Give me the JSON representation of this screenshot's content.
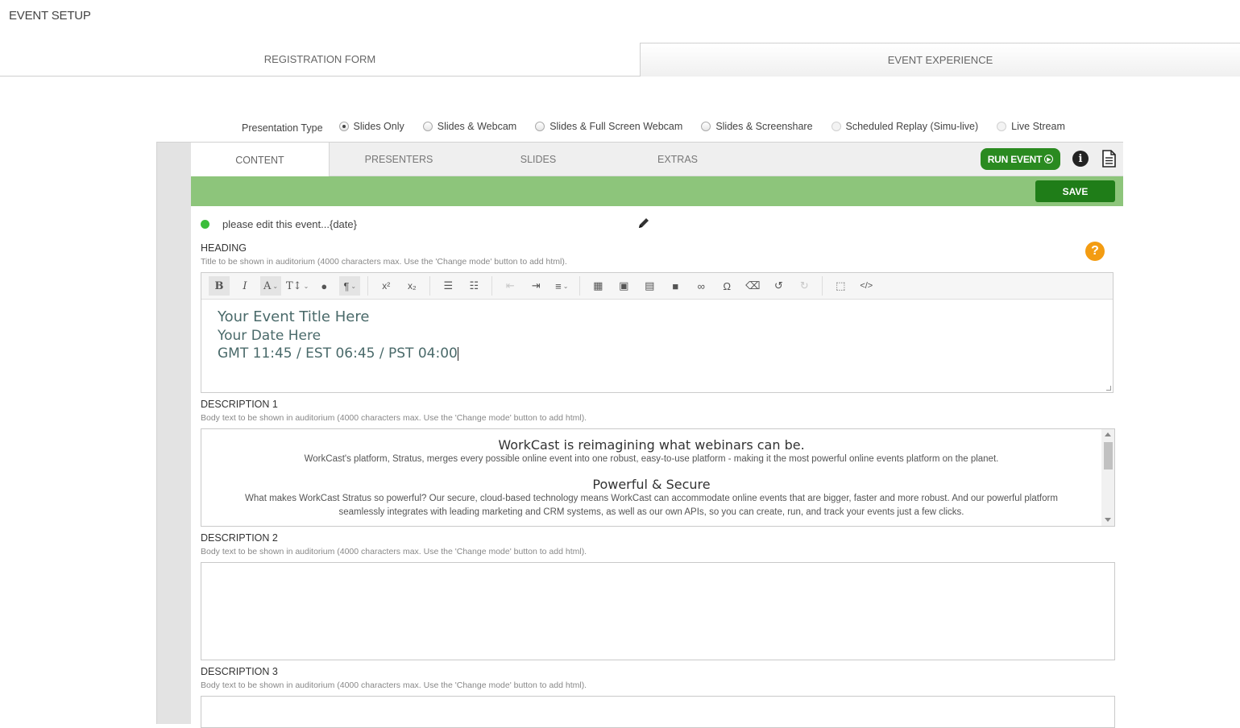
{
  "page": {
    "title": "EVENT SETUP"
  },
  "top_tabs": [
    {
      "label": "REGISTRATION FORM"
    },
    {
      "label": "EVENT EXPERIENCE"
    }
  ],
  "presentation_type": {
    "label": "Presentation Type",
    "options": [
      {
        "label": "Slides Only",
        "selected": true
      },
      {
        "label": "Slides & Webcam"
      },
      {
        "label": "Slides & Full Screen Webcam"
      },
      {
        "label": "Slides & Screenshare"
      },
      {
        "label": "Scheduled Replay (Simu-live)"
      },
      {
        "label": "Live Stream"
      }
    ]
  },
  "sub_tabs": [
    {
      "label": "CONTENT"
    },
    {
      "label": "PRESENTERS"
    },
    {
      "label": "SLIDES"
    },
    {
      "label": "EXTRAS"
    }
  ],
  "actions": {
    "run_event": "RUN EVENT",
    "save": "SAVE"
  },
  "event": {
    "name": "please edit this event...{date}",
    "status_color": "#3bbd3b"
  },
  "heading": {
    "label": "HEADING",
    "hint": "Title to be shown in auditorium (4000 characters max. Use the 'Change mode' button to add html).",
    "lines": [
      "Your Event Title Here",
      "Your Date Here",
      "GMT 11:45 / EST 06:45 / PST 04:00"
    ]
  },
  "descriptions": [
    {
      "label": "DESCRIPTION 1",
      "hint": "Body text to be shown in auditorium (4000 characters max. Use the 'Change mode' button to add html).",
      "h1": "WorkCast is reimagining what webinars can be.",
      "p1": "WorkCast's platform, Stratus, merges every possible online event into one robust, easy-to-use platform - making it the most powerful online events platform on the planet.",
      "h2": "Powerful & Secure",
      "p2": "What makes WorkCast Stratus so powerful? Our secure, cloud-based technology means WorkCast can accommodate online events that are bigger, faster and more robust. And our powerful platform seamlessly integrates with leading marketing and CRM systems, as well as our own APIs, so you can create, run, and track your events just a few clicks."
    },
    {
      "label": "DESCRIPTION 2",
      "hint": "Body text to be shown in auditorium (4000 characters max. Use the 'Change mode' button to add html)."
    },
    {
      "label": "DESCRIPTION 3",
      "hint": "Body text to be shown in auditorium (4000 characters max. Use the 'Change mode' button to add html)."
    }
  ],
  "colors": {
    "accent_green": "#2a8a20",
    "bar_green": "#8dc57b",
    "help_orange": "#f39c12"
  }
}
